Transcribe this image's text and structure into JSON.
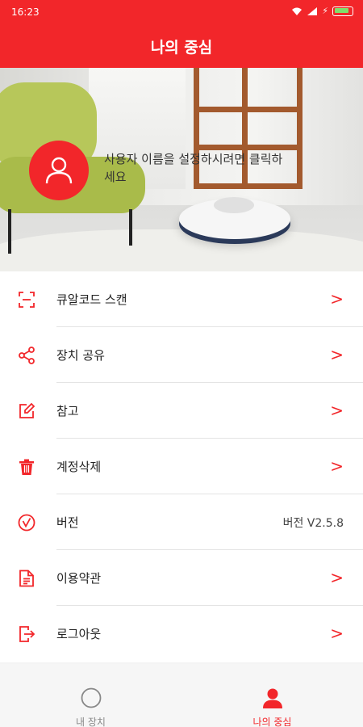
{
  "status_bar": {
    "time": "16:23",
    "battery_icon": "battery-icon",
    "signal_icon": "signal-icon",
    "wifi_icon": "wifi-icon"
  },
  "app_bar": {
    "title": "나의 중심"
  },
  "profile": {
    "hint": "사용자 이름을 설정하시려면 클릭하세요",
    "avatar_icon": "user-icon"
  },
  "menu": [
    {
      "label": "큐알코드 스캔",
      "icon": "qr-scan-icon",
      "arrow": ">"
    },
    {
      "label": "장치 공유",
      "icon": "share-icon",
      "arrow": ">"
    },
    {
      "label": "참고",
      "icon": "edit-icon",
      "arrow": ">"
    },
    {
      "label": "계정삭제",
      "icon": "trash-icon",
      "arrow": ">"
    },
    {
      "label": "버전",
      "icon": "version-icon",
      "value": "버전 V2.5.8"
    },
    {
      "label": "이용약관",
      "icon": "document-icon",
      "arrow": ">"
    },
    {
      "label": "로그아웃",
      "icon": "logout-icon",
      "arrow": ">"
    }
  ],
  "tabs": [
    {
      "label": "내 장치",
      "icon": "device-icon",
      "active": false
    },
    {
      "label": "나의 중심",
      "icon": "user-icon",
      "active": true
    }
  ],
  "colors": {
    "accent": "#f2262a",
    "tab_inactive": "#888888"
  }
}
